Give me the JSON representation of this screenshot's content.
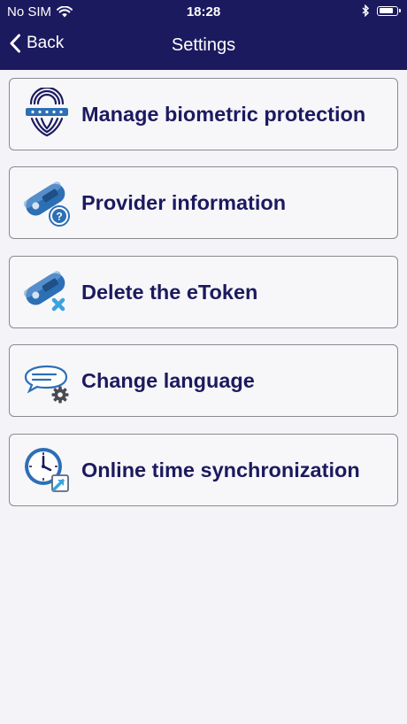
{
  "status_bar": {
    "carrier": "No SIM",
    "time": "18:28"
  },
  "nav": {
    "back_label": "Back",
    "title": "Settings"
  },
  "items": [
    {
      "label": "Manage biometric protection",
      "icon": "fingerprint-icon"
    },
    {
      "label": "Provider information",
      "icon": "token-info-icon"
    },
    {
      "label": "Delete the eToken",
      "icon": "token-delete-icon"
    },
    {
      "label": "Change language",
      "icon": "speech-gear-icon"
    },
    {
      "label": "Online time synchronization",
      "icon": "clock-sync-icon"
    }
  ],
  "colors": {
    "navbar": "#1c1a5e",
    "text": "#1c1a5e",
    "background": "#f3f3f8",
    "border": "#8a8a8f",
    "icon_blue": "#2d6fb5"
  }
}
